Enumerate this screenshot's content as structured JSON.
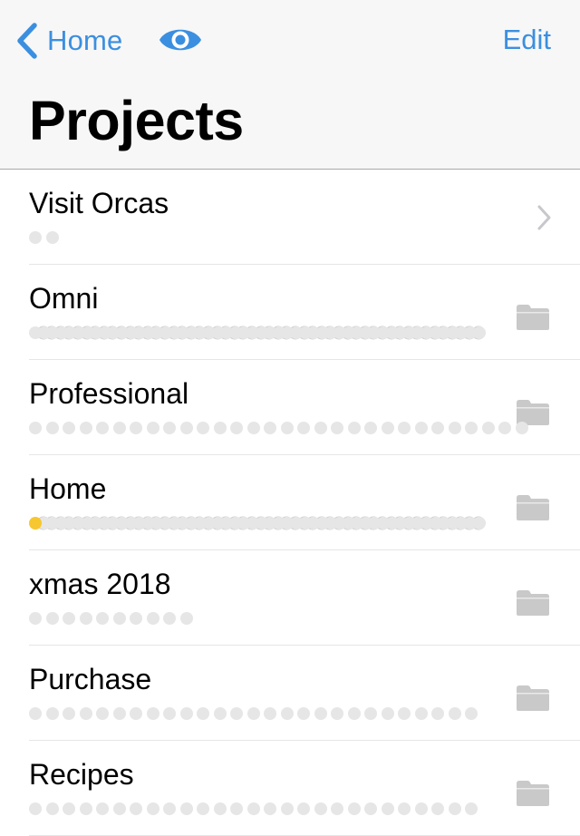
{
  "nav": {
    "back_label": "Home",
    "back_icon": "chevron-left-icon",
    "view_icon": "eye-icon",
    "edit_label": "Edit",
    "title": "Projects",
    "accent_color": "#3b8fe0"
  },
  "projects": [
    {
      "name": "Visit Orcas",
      "count": 2,
      "style": "spaced",
      "accessory": "chevron-right-icon",
      "highlight_first": false
    },
    {
      "name": "Omni",
      "count": 52,
      "style": "stacked",
      "accessory": "folder-icon",
      "highlight_first": false
    },
    {
      "name": "Professional",
      "count": 30,
      "style": "spaced",
      "accessory": "folder-icon",
      "highlight_first": false
    },
    {
      "name": "Home",
      "count": 52,
      "style": "stacked",
      "accessory": "folder-icon",
      "highlight_first": true
    },
    {
      "name": "xmas 2018",
      "count": 10,
      "style": "spaced",
      "accessory": "folder-icon",
      "highlight_first": false
    },
    {
      "name": "Purchase",
      "count": 27,
      "style": "spaced",
      "accessory": "folder-icon",
      "highlight_first": false
    },
    {
      "name": "Recipes",
      "count": 27,
      "style": "spaced",
      "accessory": "folder-icon",
      "highlight_first": false
    }
  ],
  "colors": {
    "dot": "#e6e6e6",
    "dot_highlight": "#f6c730",
    "icon_gray": "#c7c7cc"
  }
}
